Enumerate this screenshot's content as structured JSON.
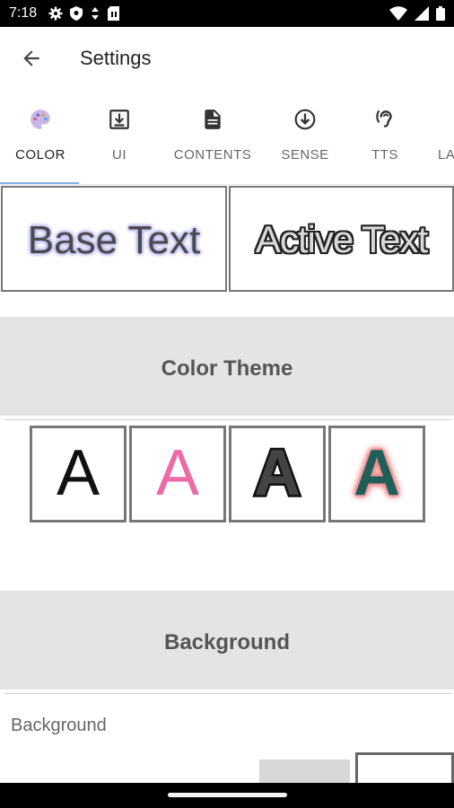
{
  "status_bar": {
    "time": "7:18",
    "left_icons": [
      "gear-icon",
      "shield-icon",
      "download-arrows-icon",
      "sim-card-icon"
    ],
    "right_icons": [
      "wifi-icon",
      "cellular-signal-icon",
      "battery-icon"
    ]
  },
  "app_bar": {
    "title": "Settings",
    "back_icon": "arrow-left-icon"
  },
  "tabs": [
    {
      "label": "COLOR",
      "icon": "palette-icon",
      "active": true
    },
    {
      "label": "UI",
      "icon": "download-box-icon",
      "active": false
    },
    {
      "label": "CONTENTS",
      "icon": "document-icon",
      "active": false
    },
    {
      "label": "SENSE",
      "icon": "arrow-down-circle-icon",
      "active": false
    },
    {
      "label": "TTS",
      "icon": "ear-icon",
      "active": false
    },
    {
      "label": "LA",
      "icon": "",
      "active": false
    }
  ],
  "preview": {
    "base_text": "Base Text",
    "active_text": "Active Text"
  },
  "sections": {
    "color_theme": "Color Theme",
    "background": "Background"
  },
  "themes": [
    {
      "letter": "A",
      "color": "#111111",
      "outline": "none"
    },
    {
      "letter": "A",
      "color": "#ee6aa7",
      "outline": "none"
    },
    {
      "letter": "A",
      "color": "#444444",
      "outline": "#111111"
    },
    {
      "letter": "A",
      "color": "#1f5f5a",
      "outline": "#f08c8c"
    }
  ],
  "background_row": {
    "label": "Background"
  },
  "colors": {
    "accent_indicator": "#7fb4e6",
    "section_bg": "#e4e4e4",
    "tile_border": "#777777"
  }
}
